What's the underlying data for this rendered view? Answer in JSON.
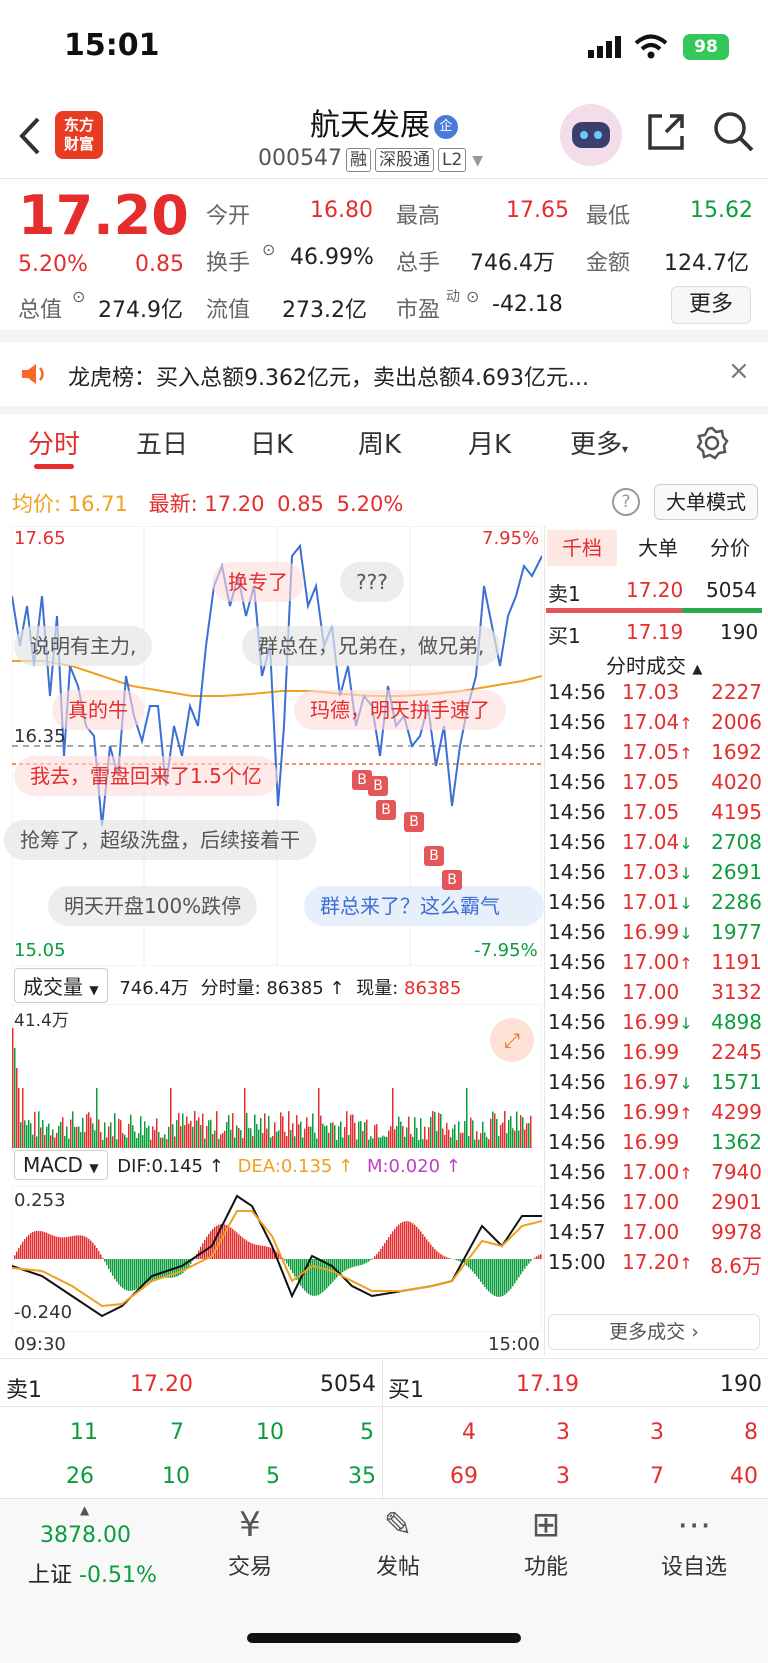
{
  "status": {
    "time": "15:01",
    "battery": "98"
  },
  "header": {
    "logo_line1": "东方",
    "logo_line2": "财富",
    "name": "航天发展",
    "badge": "企",
    "code": "000547",
    "tags": [
      "融",
      "深股通",
      "L2"
    ]
  },
  "quote": {
    "price": "17.20",
    "change_pct": "5.20%",
    "change": "0.85",
    "labels": {
      "open": "今开",
      "high": "最高",
      "low": "最低",
      "turnover": "换手",
      "volume": "总手",
      "amount": "金额",
      "total_mv": "总值",
      "float_mv": "流值",
      "pe": "市盈",
      "pe_sup": "动"
    },
    "open": "16.80",
    "high": "17.65",
    "low": "15.62",
    "turnover": "46.99%",
    "volume": "746.4万",
    "amount": "124.7亿",
    "total_mv": "274.9亿",
    "float_mv": "273.2亿",
    "pe": "-42.18",
    "more": "更多"
  },
  "notice": {
    "text": "龙虎榜：买入总额9.362亿元，卖出总额4.693亿元..."
  },
  "tabs": [
    "分时",
    "五日",
    "日K",
    "周K",
    "月K",
    "更多"
  ],
  "chart": {
    "avg_label": "均价:",
    "avg": "16.71",
    "latest_label": "最新:",
    "latest": "17.20",
    "latest_chg": "0.85",
    "latest_pct": "5.20%",
    "mode_btn": "大单模式",
    "y_top": "17.65",
    "y_mid": "16.35",
    "y_bot": "15.05",
    "pct_top": "7.95%",
    "pct_bot": "-7.95%",
    "vol_label": "成交量",
    "vol_total": "746.4万",
    "vol_split_label": "分时量:",
    "vol_split": "86385",
    "vol_now_label": "现量:",
    "vol_now": "86385",
    "vol_max": "41.4万",
    "macd_label": "MACD",
    "dif": "DIF:0.145",
    "dea": "DEA:0.135",
    "m": "M:0.020",
    "macd_top": "0.253",
    "macd_bot": "-0.240",
    "time_start": "09:30",
    "time_end": "15:00",
    "colors": {
      "price_line": "#3b6fd4",
      "avg_line": "#f0a020",
      "up": "#e52d2d",
      "down": "#0a9d3c"
    }
  },
  "barrages": [
    {
      "text": "换专了",
      "red": true
    },
    {
      "text": "???",
      "red": false
    },
    {
      "text": "说明有主力,",
      "red": false
    },
    {
      "text": "群总在，兄弟在，做兄弟,",
      "red": false
    },
    {
      "text": "真的牛",
      "red": true
    },
    {
      "text": "玛德，明天拼手速了",
      "red": true
    },
    {
      "text": "我去，雷盘回来了1.5个亿",
      "red": true
    },
    {
      "text": "抢筹了，超级洗盘，后续接着干",
      "red": false
    },
    {
      "text": "明天开盘100%跌停",
      "red": false
    },
    {
      "text": "群总来了？这么霸气",
      "red": false
    }
  ],
  "right_panel": {
    "tabs": [
      "千档",
      "大单",
      "分价"
    ],
    "sell1_label": "卖1",
    "sell1_price": "17.20",
    "sell1_vol": "5054",
    "buy1_label": "买1",
    "buy1_price": "17.19",
    "buy1_vol": "190",
    "trades_title": "分时成交",
    "trades": [
      {
        "t": "14:56",
        "p": "17.03",
        "d": "",
        "v": "2227",
        "c": "red"
      },
      {
        "t": "14:56",
        "p": "17.04",
        "d": "↑",
        "v": "2006",
        "c": "red"
      },
      {
        "t": "14:56",
        "p": "17.05",
        "d": "↑",
        "v": "1692",
        "c": "red"
      },
      {
        "t": "14:56",
        "p": "17.05",
        "d": "",
        "v": "4020",
        "c": "red"
      },
      {
        "t": "14:56",
        "p": "17.05",
        "d": "",
        "v": "4195",
        "c": "red"
      },
      {
        "t": "14:56",
        "p": "17.04",
        "d": "↓",
        "v": "2708",
        "c": "green"
      },
      {
        "t": "14:56",
        "p": "17.03",
        "d": "↓",
        "v": "2691",
        "c": "green"
      },
      {
        "t": "14:56",
        "p": "17.01",
        "d": "↓",
        "v": "2286",
        "c": "green"
      },
      {
        "t": "14:56",
        "p": "16.99",
        "d": "↓",
        "v": "1977",
        "c": "green"
      },
      {
        "t": "14:56",
        "p": "17.00",
        "d": "↑",
        "v": "1191",
        "c": "red"
      },
      {
        "t": "14:56",
        "p": "17.00",
        "d": "",
        "v": "3132",
        "c": "red"
      },
      {
        "t": "14:56",
        "p": "16.99",
        "d": "↓",
        "v": "4898",
        "c": "green"
      },
      {
        "t": "14:56",
        "p": "16.99",
        "d": "",
        "v": "2245",
        "c": "red"
      },
      {
        "t": "14:56",
        "p": "16.97",
        "d": "↓",
        "v": "1571",
        "c": "green"
      },
      {
        "t": "14:56",
        "p": "16.99",
        "d": "↑",
        "v": "4299",
        "c": "red"
      },
      {
        "t": "14:56",
        "p": "16.99",
        "d": "",
        "v": "1362",
        "c": "green"
      },
      {
        "t": "14:56",
        "p": "17.00",
        "d": "↑",
        "v": "7940",
        "c": "red"
      },
      {
        "t": "14:56",
        "p": "17.00",
        "d": "",
        "v": "2901",
        "c": "red"
      },
      {
        "t": "14:57",
        "p": "17.00",
        "d": "",
        "v": "9978",
        "c": "red"
      },
      {
        "t": "15:00",
        "p": "17.20",
        "d": "↑",
        "v": "8.6万",
        "c": "red"
      }
    ],
    "more_trades": "更多成交"
  },
  "orderbook": {
    "sell_label": "卖1",
    "sell_price": "17.20",
    "sell_vol": "5054",
    "buy_label": "买1",
    "buy_price": "17.19",
    "buy_vol": "190",
    "sell_row1": [
      "11",
      "7",
      "10",
      "5"
    ],
    "sell_row2": [
      "26",
      "10",
      "5",
      "35"
    ],
    "buy_row1": [
      "4",
      "3",
      "3",
      "8"
    ],
    "buy_row2": [
      "69",
      "3",
      "7",
      "40"
    ]
  },
  "bottom_nav": {
    "index_value": "3878.00",
    "index_name": "上证",
    "index_chg": "-0.51%",
    "items": [
      "交易",
      "发帖",
      "功能",
      "设自选"
    ]
  }
}
